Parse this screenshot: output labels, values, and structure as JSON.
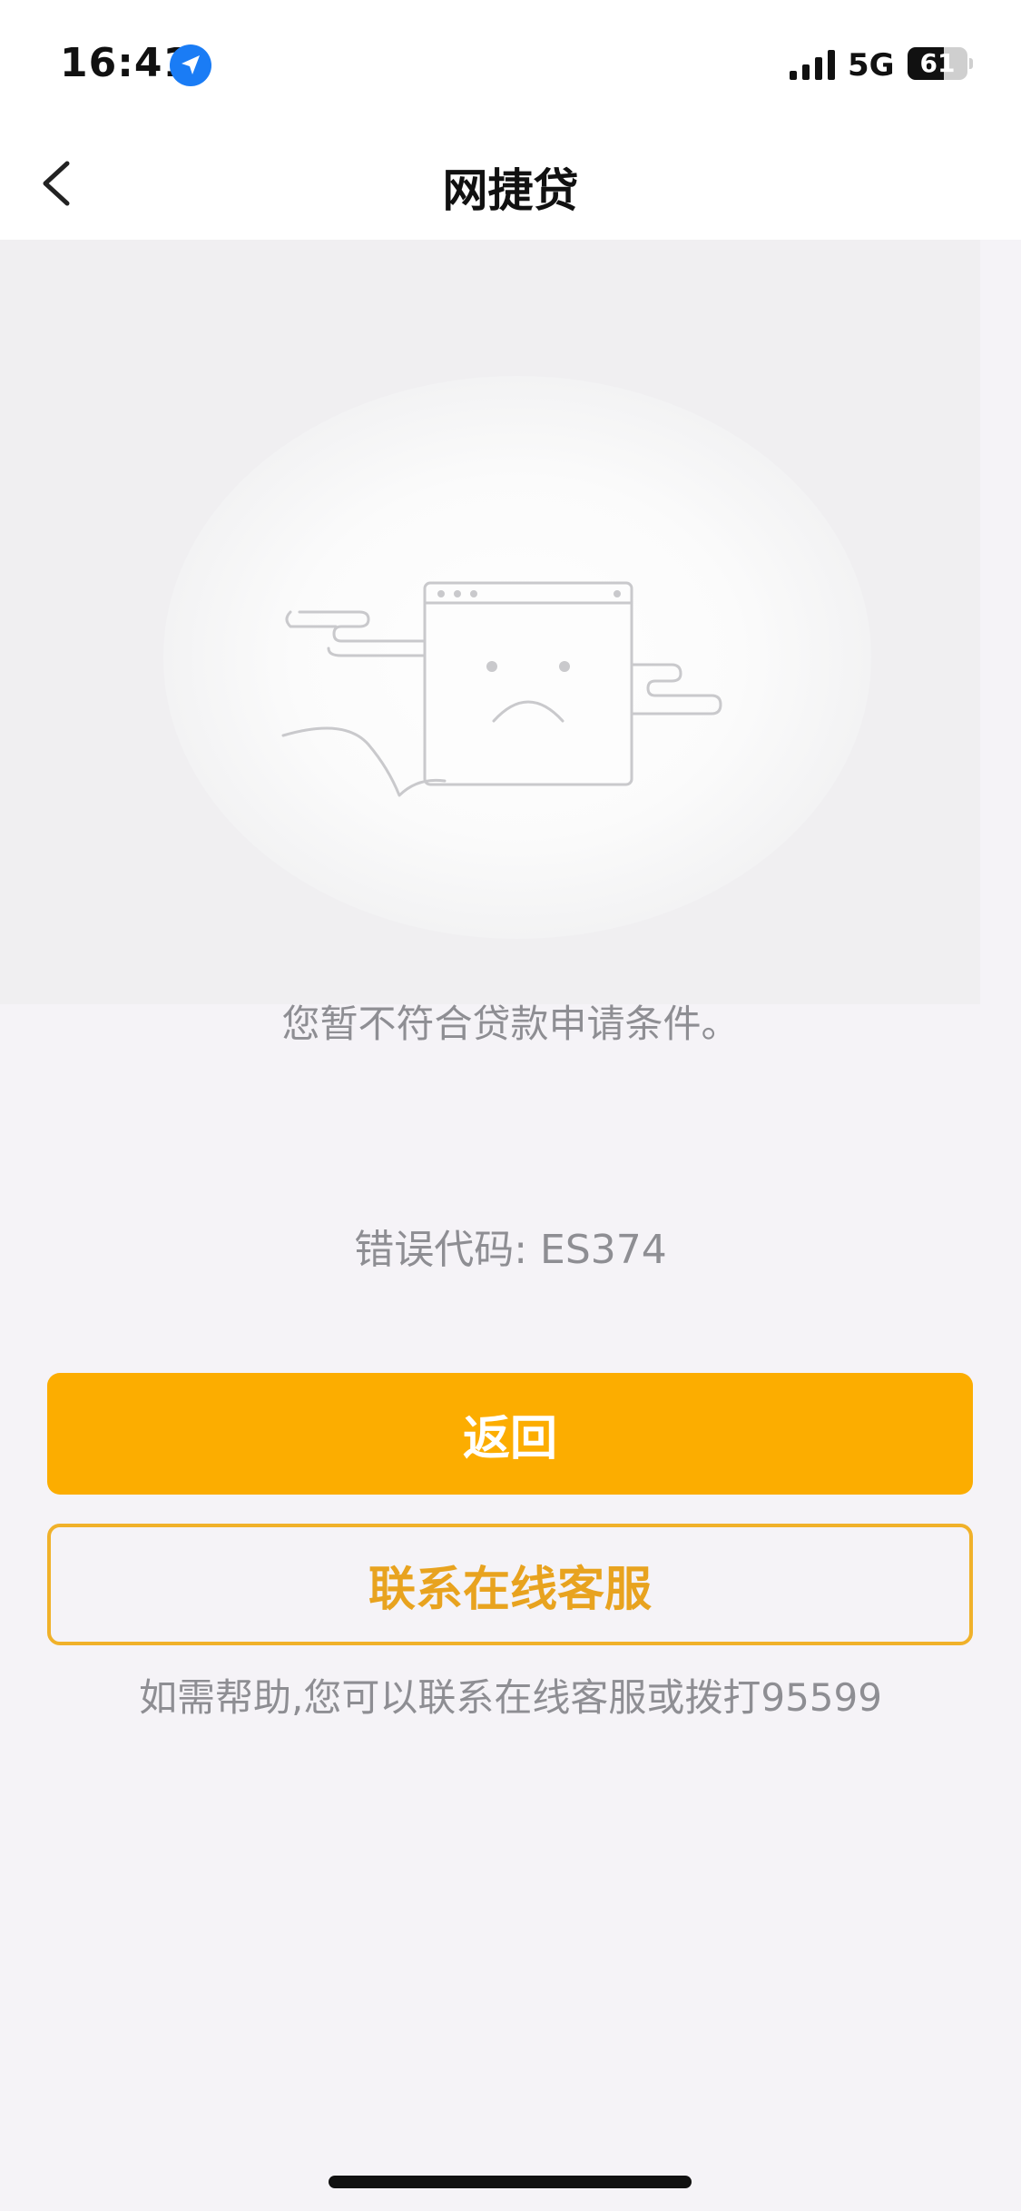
{
  "status_bar": {
    "time": "16:41",
    "network": "5G",
    "battery": "61",
    "battery_level": 0.61
  },
  "nav": {
    "title": "网捷贷"
  },
  "main": {
    "message": "您暂不符合贷款申请条件。",
    "error_code": "错误代码: ES374",
    "return_label": "返回",
    "service_label": "联系在线客服",
    "help_text": "如需帮助,您可以联系在线客服或拨打95599"
  },
  "colors": {
    "primary_button": "#fcad00",
    "outline_button": "#f0b12a",
    "background": "#f5f3f7"
  }
}
